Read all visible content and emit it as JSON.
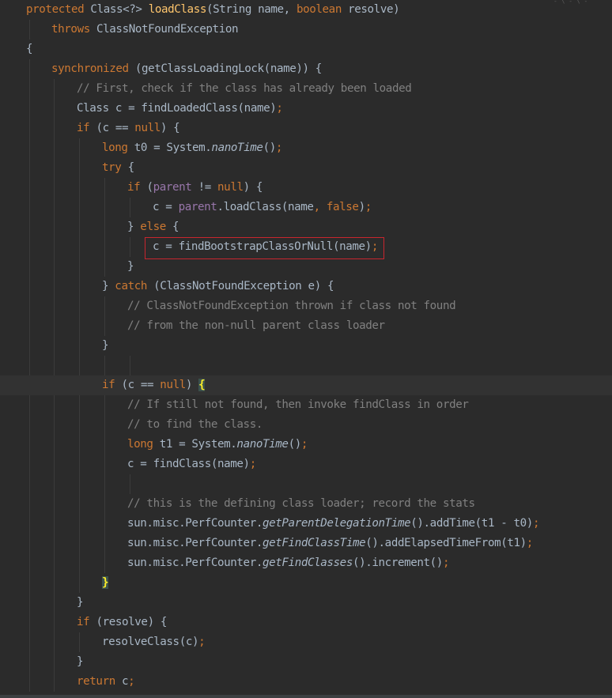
{
  "editor": {
    "language": "java",
    "theme_colors": {
      "background": "#2b2b2b",
      "keyword": "#cc7832",
      "method_declaration": "#ffc66d",
      "field": "#9876aa",
      "comment": "#808080",
      "text": "#a9b7c6",
      "box_border": "#c8262e",
      "brace_match": "#ffef28"
    },
    "lines": [
      [
        [
          "kw",
          "protected "
        ],
        [
          "plain",
          "Class<?> "
        ],
        [
          "method",
          "loadClass"
        ],
        [
          "plain",
          "(String name, "
        ],
        [
          "kw",
          "boolean "
        ],
        [
          "plain",
          "resolve)"
        ]
      ],
      [
        [
          "kw",
          "throws "
        ],
        [
          "plain",
          "ClassNotFoundException"
        ]
      ],
      [
        [
          "plain",
          "{"
        ]
      ],
      [
        [
          "kw",
          "synchronized "
        ],
        [
          "plain",
          "(getClassLoadingLock(name)) {"
        ]
      ],
      [
        [
          "comment",
          "// First, check if the class has already been loaded"
        ]
      ],
      [
        [
          "plain",
          "Class c = findLoadedClass(name)"
        ],
        [
          "semi",
          ";"
        ]
      ],
      [
        [
          "kw",
          "if "
        ],
        [
          "plain",
          "(c == "
        ],
        [
          "kw",
          "null"
        ],
        [
          "plain",
          ") {"
        ]
      ],
      [
        [
          "kw",
          "long "
        ],
        [
          "plain",
          "t0 = System."
        ],
        [
          "static",
          "nanoTime"
        ],
        [
          "plain",
          "()"
        ],
        [
          "semi",
          ";"
        ]
      ],
      [
        [
          "kw",
          "try "
        ],
        [
          "plain",
          "{"
        ]
      ],
      [
        [
          "kw",
          "if "
        ],
        [
          "plain",
          "("
        ],
        [
          "field",
          "parent "
        ],
        [
          "plain",
          "!= "
        ],
        [
          "kw",
          "null"
        ],
        [
          "plain",
          ") {"
        ]
      ],
      [
        [
          "plain",
          "c = "
        ],
        [
          "field",
          "parent"
        ],
        [
          "plain",
          ".loadClass(name"
        ],
        [
          "semi",
          ", "
        ],
        [
          "kw",
          "false"
        ],
        [
          "plain",
          ")"
        ],
        [
          "semi",
          ";"
        ]
      ],
      [
        [
          "plain",
          "} "
        ],
        [
          "kw",
          "else "
        ],
        [
          "plain",
          "{"
        ]
      ],
      [
        [
          "plain",
          "c = findBootstrapClassOrNull(name)"
        ],
        [
          "semi",
          ";"
        ]
      ],
      [
        [
          "plain",
          "}"
        ]
      ],
      [
        [
          "plain",
          "} "
        ],
        [
          "kw",
          "catch "
        ],
        [
          "plain",
          "(ClassNotFoundException e) {"
        ]
      ],
      [
        [
          "comment",
          "// ClassNotFoundException thrown if class not found"
        ]
      ],
      [
        [
          "comment",
          "// from the non-null parent class loader"
        ]
      ],
      [
        [
          "plain",
          "}"
        ]
      ],
      [],
      [
        [
          "kw",
          "if "
        ],
        [
          "plain",
          "(c == "
        ],
        [
          "kw",
          "null"
        ],
        [
          "plain",
          ") "
        ],
        [
          "bracehl",
          "{"
        ]
      ],
      [
        [
          "comment",
          "// If still not found, then invoke findClass in order"
        ]
      ],
      [
        [
          "comment",
          "// to find the class."
        ]
      ],
      [
        [
          "kw",
          "long "
        ],
        [
          "plain",
          "t1 = System."
        ],
        [
          "static",
          "nanoTime"
        ],
        [
          "plain",
          "()"
        ],
        [
          "semi",
          ";"
        ]
      ],
      [
        [
          "plain",
          "c = findClass(name)"
        ],
        [
          "semi",
          ";"
        ]
      ],
      [],
      [
        [
          "comment",
          "// this is the defining class loader; record the stats"
        ]
      ],
      [
        [
          "plain",
          "sun.misc.PerfCounter."
        ],
        [
          "static",
          "getParentDelegationTime"
        ],
        [
          "plain",
          "().addTime(t1 - t0)"
        ],
        [
          "semi",
          ";"
        ]
      ],
      [
        [
          "plain",
          "sun.misc.PerfCounter."
        ],
        [
          "static",
          "getFindClassTime"
        ],
        [
          "plain",
          "().addElapsedTimeFrom(t1)"
        ],
        [
          "semi",
          ";"
        ]
      ],
      [
        [
          "plain",
          "sun.misc.PerfCounter."
        ],
        [
          "static",
          "getFindClasses"
        ],
        [
          "plain",
          "().increment()"
        ],
        [
          "semi",
          ";"
        ]
      ],
      [
        [
          "bracehl",
          "}"
        ]
      ],
      [
        [
          "plain",
          "}"
        ]
      ],
      [
        [
          "kw",
          "if "
        ],
        [
          "plain",
          "(resolve) {"
        ]
      ],
      [
        [
          "plain",
          "resolveClass(c)"
        ],
        [
          "semi",
          ";"
        ]
      ],
      [
        [
          "plain",
          "}"
        ]
      ],
      [
        [
          "kw",
          "return "
        ],
        [
          "plain",
          "c"
        ],
        [
          "semi",
          ";"
        ]
      ]
    ],
    "highlighted_line_index": 12,
    "current_line_index": 19,
    "topstrip_text": "-  \\  -  \\  -"
  }
}
